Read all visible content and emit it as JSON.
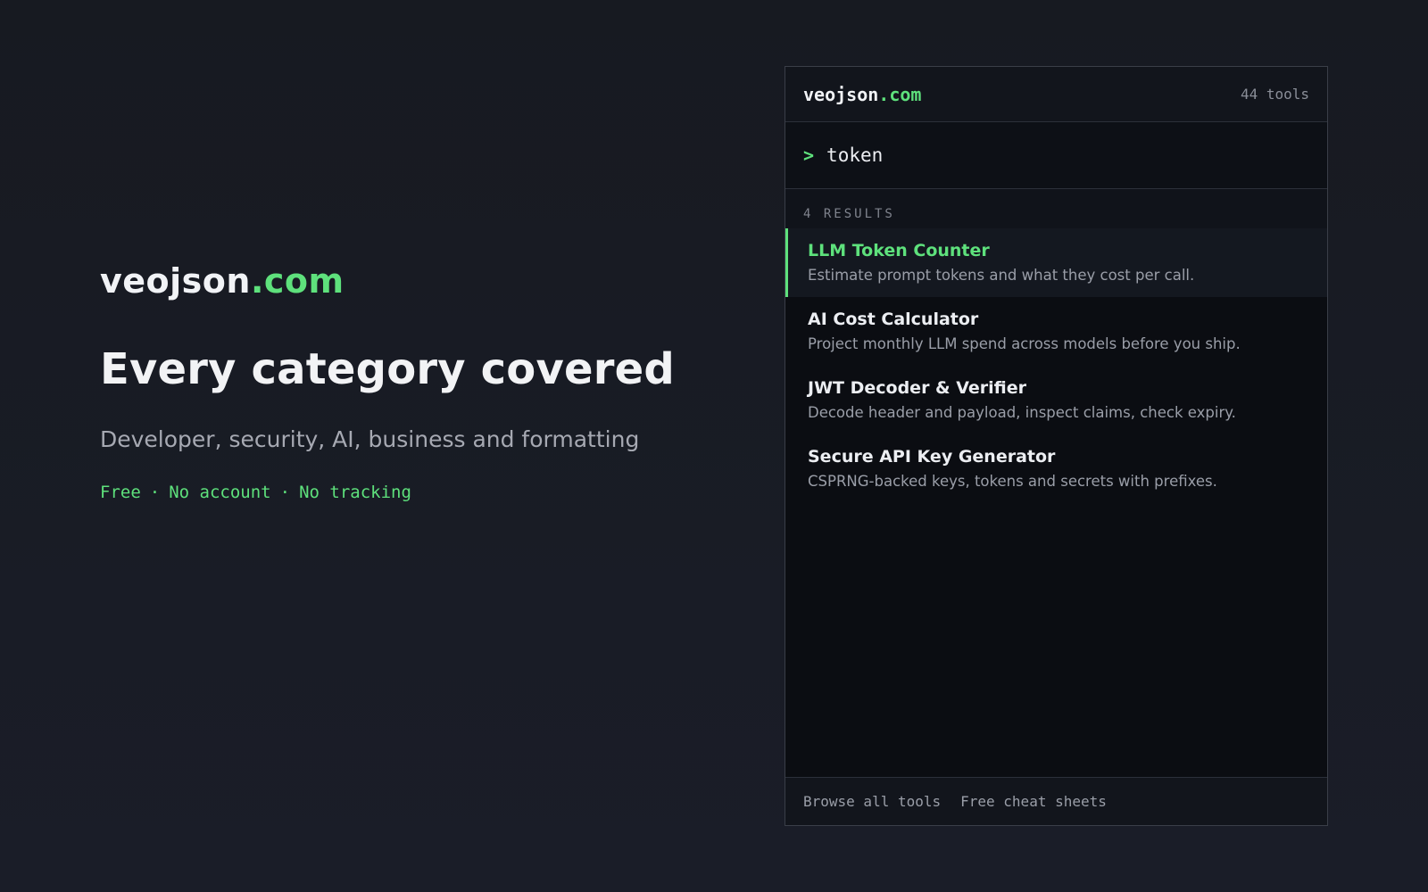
{
  "hero": {
    "brand_main": "veojson",
    "brand_accent": ".com",
    "headline": "Every category covered",
    "subhead": "Developer, security, AI, business and formatting",
    "tagline": [
      "Free",
      "No account",
      "No tracking"
    ],
    "separator": "·"
  },
  "panel": {
    "brand_main": "veojson",
    "brand_accent": ".com",
    "tool_count": "44 tools",
    "search": {
      "prompt": ">",
      "value": "token"
    },
    "results_label": "4 RESULTS",
    "results": [
      {
        "title": "LLM Token Counter",
        "desc": "Estimate prompt tokens and what they cost per call.",
        "active": true
      },
      {
        "title": "AI Cost Calculator",
        "desc": "Project monthly LLM spend across models before you ship.",
        "active": false
      },
      {
        "title": "JWT Decoder & Verifier",
        "desc": "Decode header and payload, inspect claims, check expiry.",
        "active": false
      },
      {
        "title": "Secure API Key Generator",
        "desc": "CSPRNG-backed keys, tokens and secrets with prefixes.",
        "active": false
      }
    ],
    "footer": {
      "browse_label": "Browse all tools",
      "cheatsheets_label": "Free cheat sheets"
    }
  },
  "colors": {
    "accent": "#5ee17c",
    "background": "#171a21",
    "panel_bg": "#0b0d12",
    "muted_text": "#9a9ea8"
  }
}
